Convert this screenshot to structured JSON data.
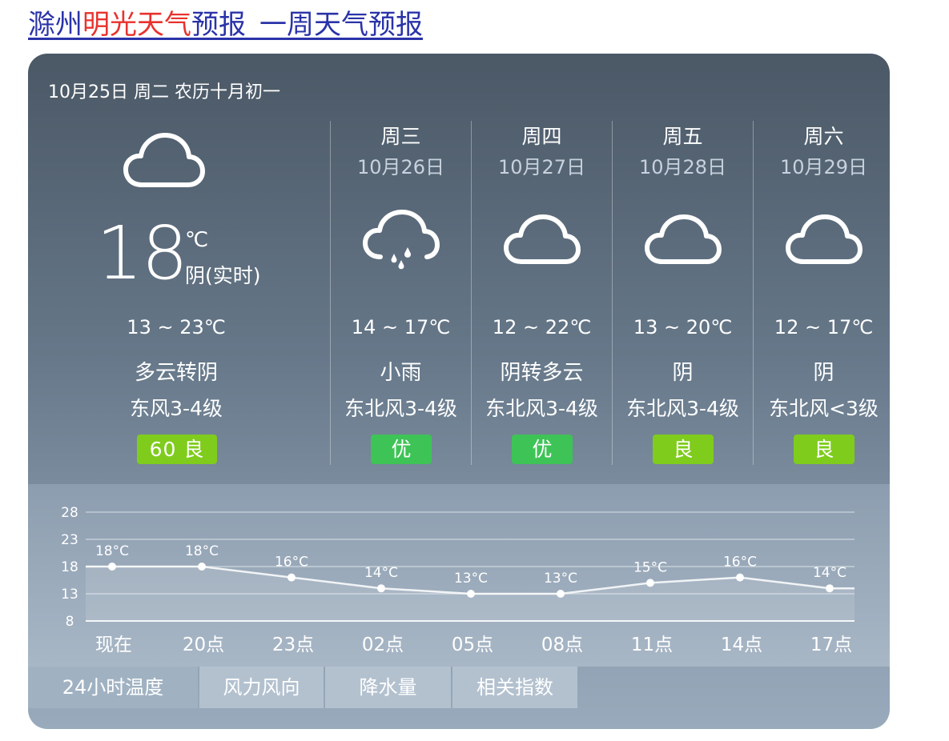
{
  "header": {
    "title_part1": "滁州",
    "title_part2": "明光天气",
    "title_part3": "预报_一周天气预报"
  },
  "today": {
    "date_line": "10月25日 周二 农历十月初一",
    "icon": "cloud-icon",
    "current_temp": "18",
    "unit": "℃",
    "current_desc": "阴(实时)",
    "range": "13 ~ 23℃",
    "weather": "多云转阴",
    "wind": "东风3-4级",
    "aqi": "60  良",
    "aqi_color": "#7fcc1d"
  },
  "forecast": [
    {
      "day": "周三",
      "date": "10月26日",
      "icon": "rain-cloud-icon",
      "range": "14 ~ 17℃",
      "weather": "小雨",
      "wind": "东北风3-4级",
      "aqi": "优",
      "aqi_color": "#3ec356"
    },
    {
      "day": "周四",
      "date": "10月27日",
      "icon": "cloud-icon",
      "range": "12 ~ 22℃",
      "weather": "阴转多云",
      "wind": "东北风3-4级",
      "aqi": "优",
      "aqi_color": "#3ec356"
    },
    {
      "day": "周五",
      "date": "10月28日",
      "icon": "cloud-icon",
      "range": "13 ~ 20℃",
      "weather": "阴",
      "wind": "东北风3-4级",
      "aqi": "良",
      "aqi_color": "#7fcc1d"
    },
    {
      "day": "周六",
      "date": "10月29日",
      "icon": "cloud-icon",
      "range": "12 ~ 17℃",
      "weather": "阴",
      "wind": "东北风<3级",
      "aqi": "良",
      "aqi_color": "#7fcc1d"
    }
  ],
  "chart_data": {
    "type": "line",
    "title": "",
    "xlabel": "",
    "ylabel": "",
    "categories": [
      "现在",
      "20点",
      "23点",
      "02点",
      "05点",
      "08点",
      "11点",
      "14点",
      "17点"
    ],
    "values": [
      18,
      18,
      16,
      14,
      13,
      13,
      15,
      16,
      14
    ],
    "value_labels": [
      "18°C",
      "18°C",
      "16°C",
      "14°C",
      "13°C",
      "13°C",
      "15°C",
      "16°C",
      "14°C"
    ],
    "yticks": [
      "28",
      "23",
      "18",
      "13",
      "8"
    ],
    "ylim": [
      8,
      28
    ],
    "grid": true
  },
  "tabs": [
    {
      "label": "24小时温度",
      "active": true
    },
    {
      "label": "风力风向",
      "active": false
    },
    {
      "label": "降水量",
      "active": false
    },
    {
      "label": "相关指数",
      "active": false
    }
  ]
}
